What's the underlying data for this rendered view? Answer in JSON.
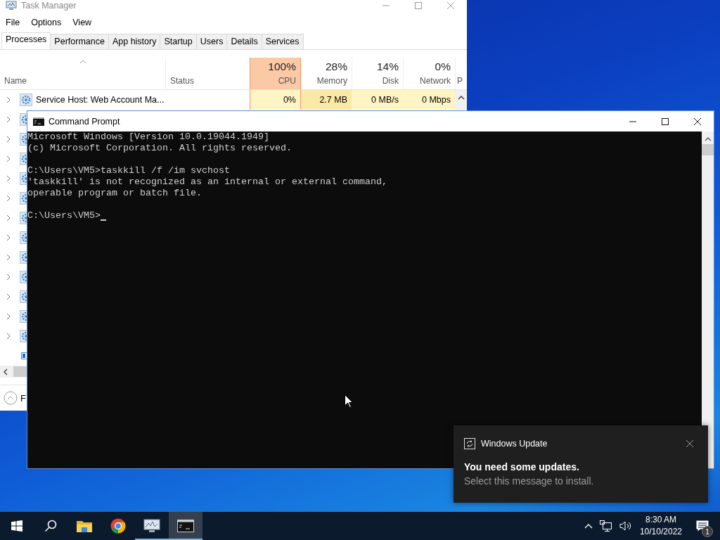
{
  "task_manager": {
    "title": "Task Manager",
    "menu": [
      "File",
      "Options",
      "View"
    ],
    "tabs": [
      {
        "label": "Processes",
        "selected": true
      },
      {
        "label": "Performance",
        "selected": false
      },
      {
        "label": "App history",
        "selected": false
      },
      {
        "label": "Startup",
        "selected": false
      },
      {
        "label": "Users",
        "selected": false
      },
      {
        "label": "Details",
        "selected": false
      },
      {
        "label": "Services",
        "selected": false
      }
    ],
    "columns": [
      {
        "kind": "text",
        "label": "Name",
        "sorted": true
      },
      {
        "kind": "text",
        "label": "Status",
        "sorted": false
      },
      {
        "kind": "metric",
        "percent": "100%",
        "label": "CPU",
        "highlighted": true,
        "sorted": false
      },
      {
        "kind": "metric",
        "percent": "28%",
        "label": "Memory",
        "highlighted": false,
        "sorted": false
      },
      {
        "kind": "metric",
        "percent": "14%",
        "label": "Disk",
        "highlighted": false,
        "sorted": false
      },
      {
        "kind": "metric",
        "percent": "0%",
        "label": "Network",
        "highlighted": false,
        "sorted": false
      },
      {
        "kind": "metric",
        "label": "P",
        "highlighted": false,
        "sorted": false
      }
    ],
    "rows": [
      {
        "expandable": true,
        "name": "Service Host: Web Account Ma...",
        "cells": [
          {
            "text": "0%",
            "strong": false
          },
          {
            "text": "2.7 MB",
            "strong": true
          },
          {
            "text": "0 MB/s",
            "strong": false
          },
          {
            "text": "0 Mbps",
            "strong": false
          }
        ]
      },
      {
        "expandable": true
      },
      {
        "expandable": true
      },
      {
        "expandable": true
      },
      {
        "expandable": true
      },
      {
        "expandable": true
      },
      {
        "expandable": true
      },
      {
        "expandable": true
      },
      {
        "expandable": true
      },
      {
        "expandable": true
      },
      {
        "expandable": true
      },
      {
        "expandable": true
      },
      {
        "expandable": true
      },
      {
        "expandable": false
      }
    ],
    "footer": {
      "label": "F"
    }
  },
  "cmd": {
    "title": "Command Prompt",
    "blocks": [
      [
        "Microsoft Windows [Version 10.0.19044.1949]",
        "(c) Microsoft Corporation. All rights reserved."
      ],
      [
        "C:\\Users\\VM5>taskkill /f /im svchost",
        "'taskkill' is not recognized as an internal or external command,",
        "operable program or batch file."
      ],
      [
        "C:\\Users\\VM5>"
      ]
    ],
    "cursor": true
  },
  "notification": {
    "app": "Windows Update",
    "title": "You need some updates.",
    "body": "Select this message to install."
  },
  "taskbar": {
    "apps": [
      {
        "kind": "start",
        "running": false,
        "active": false
      },
      {
        "kind": "search",
        "running": false,
        "active": false
      },
      {
        "kind": "folder",
        "running": false,
        "active": false
      },
      {
        "kind": "browser",
        "running": false,
        "active": false
      },
      {
        "kind": "monitor",
        "running": true,
        "active": false
      },
      {
        "kind": "console",
        "running": true,
        "active": true
      }
    ],
    "time": "8:30 AM",
    "date": "10/10/2022",
    "notifications": "1"
  }
}
